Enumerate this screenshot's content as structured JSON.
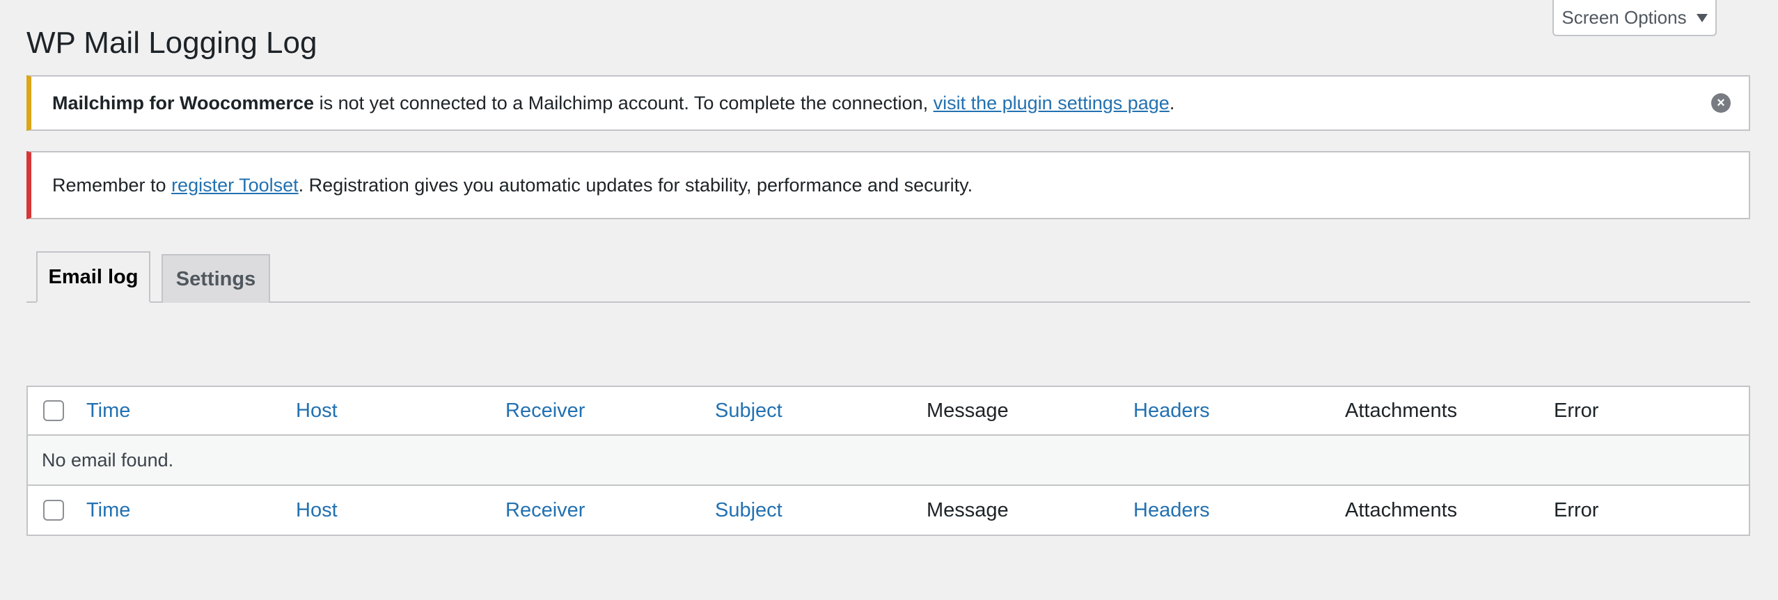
{
  "header": {
    "title": "WP Mail Logging Log",
    "screen_options_label": "Screen Options"
  },
  "notices": {
    "mailchimp": {
      "bold": "Mailchimp for Woocommerce",
      "text_before_link": " is not yet connected to a Mailchimp account. To complete the connection, ",
      "link": "visit the plugin settings page",
      "text_after_link": ".",
      "dismiss_icon": "×"
    },
    "toolset": {
      "text_before_link": "Remember to ",
      "link": "register Toolset",
      "text_after_link": ". Registration gives you automatic updates for stability, performance and security."
    }
  },
  "tabs": [
    {
      "label": "Email log",
      "active": true
    },
    {
      "label": "Settings",
      "active": false
    }
  ],
  "table": {
    "columns": [
      "Time",
      "Host",
      "Receiver",
      "Subject",
      "Message",
      "Headers",
      "Attachments",
      "Error"
    ],
    "empty_message": "No email found."
  },
  "colors": {
    "link": "#2271b1",
    "warning_border": "#dba617",
    "error_border": "#d63638",
    "background": "#f0f0f1"
  }
}
